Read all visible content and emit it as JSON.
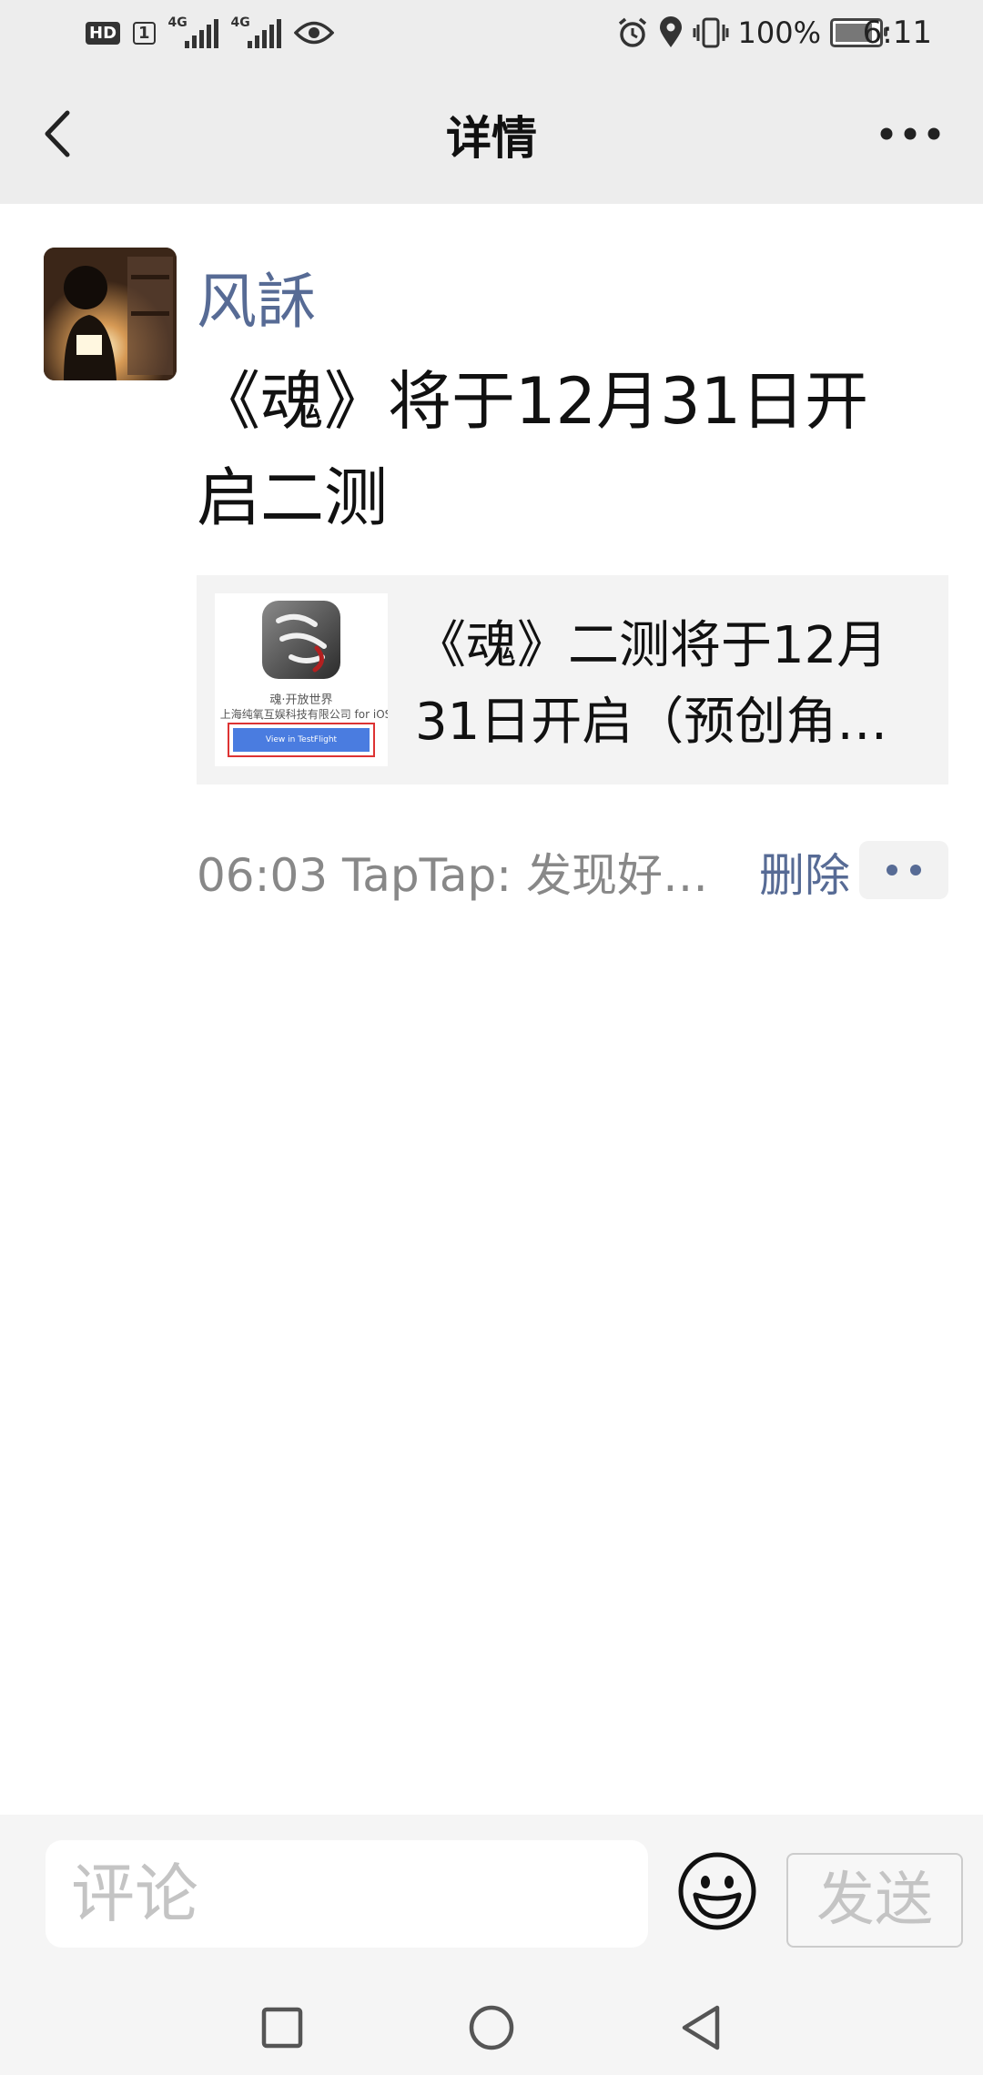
{
  "status_bar": {
    "hd_label": "HD",
    "sim_label": "1",
    "signal1_label": "4G",
    "signal2_label": "4G",
    "battery_percent_text": "100%",
    "battery_level": 1.0,
    "time": "6:11",
    "icons": [
      "eye-icon",
      "alarm-icon",
      "location-icon",
      "vibrate-icon",
      "battery-icon"
    ]
  },
  "header": {
    "title": "详情",
    "back_icon": "chevron-left-icon",
    "more_icon": "more-dots-icon"
  },
  "post": {
    "author": "风訸",
    "text": "《魂》将于12月31日开启二测",
    "link": {
      "title": "《魂》二测将于12月31日开启（预创角…",
      "thumb_caption_line1": "魂·开放世界",
      "thumb_caption_line2": "上海纯氧互娱科技有限公司 for iOS",
      "thumb_button": "View in TestFlight"
    },
    "meta": "06:03 TapTap: 发现好…",
    "delete_label": "删除"
  },
  "comment_bar": {
    "placeholder": "评论",
    "send_label": "发送",
    "emoji_icon": "emoji-icon"
  },
  "nav_bar": [
    "square-recent-icon",
    "circle-home-icon",
    "triangle-back-icon"
  ],
  "colors": {
    "link_blue": "#576b95",
    "header_bg": "#ededed",
    "card_bg": "#f3f3f3"
  }
}
